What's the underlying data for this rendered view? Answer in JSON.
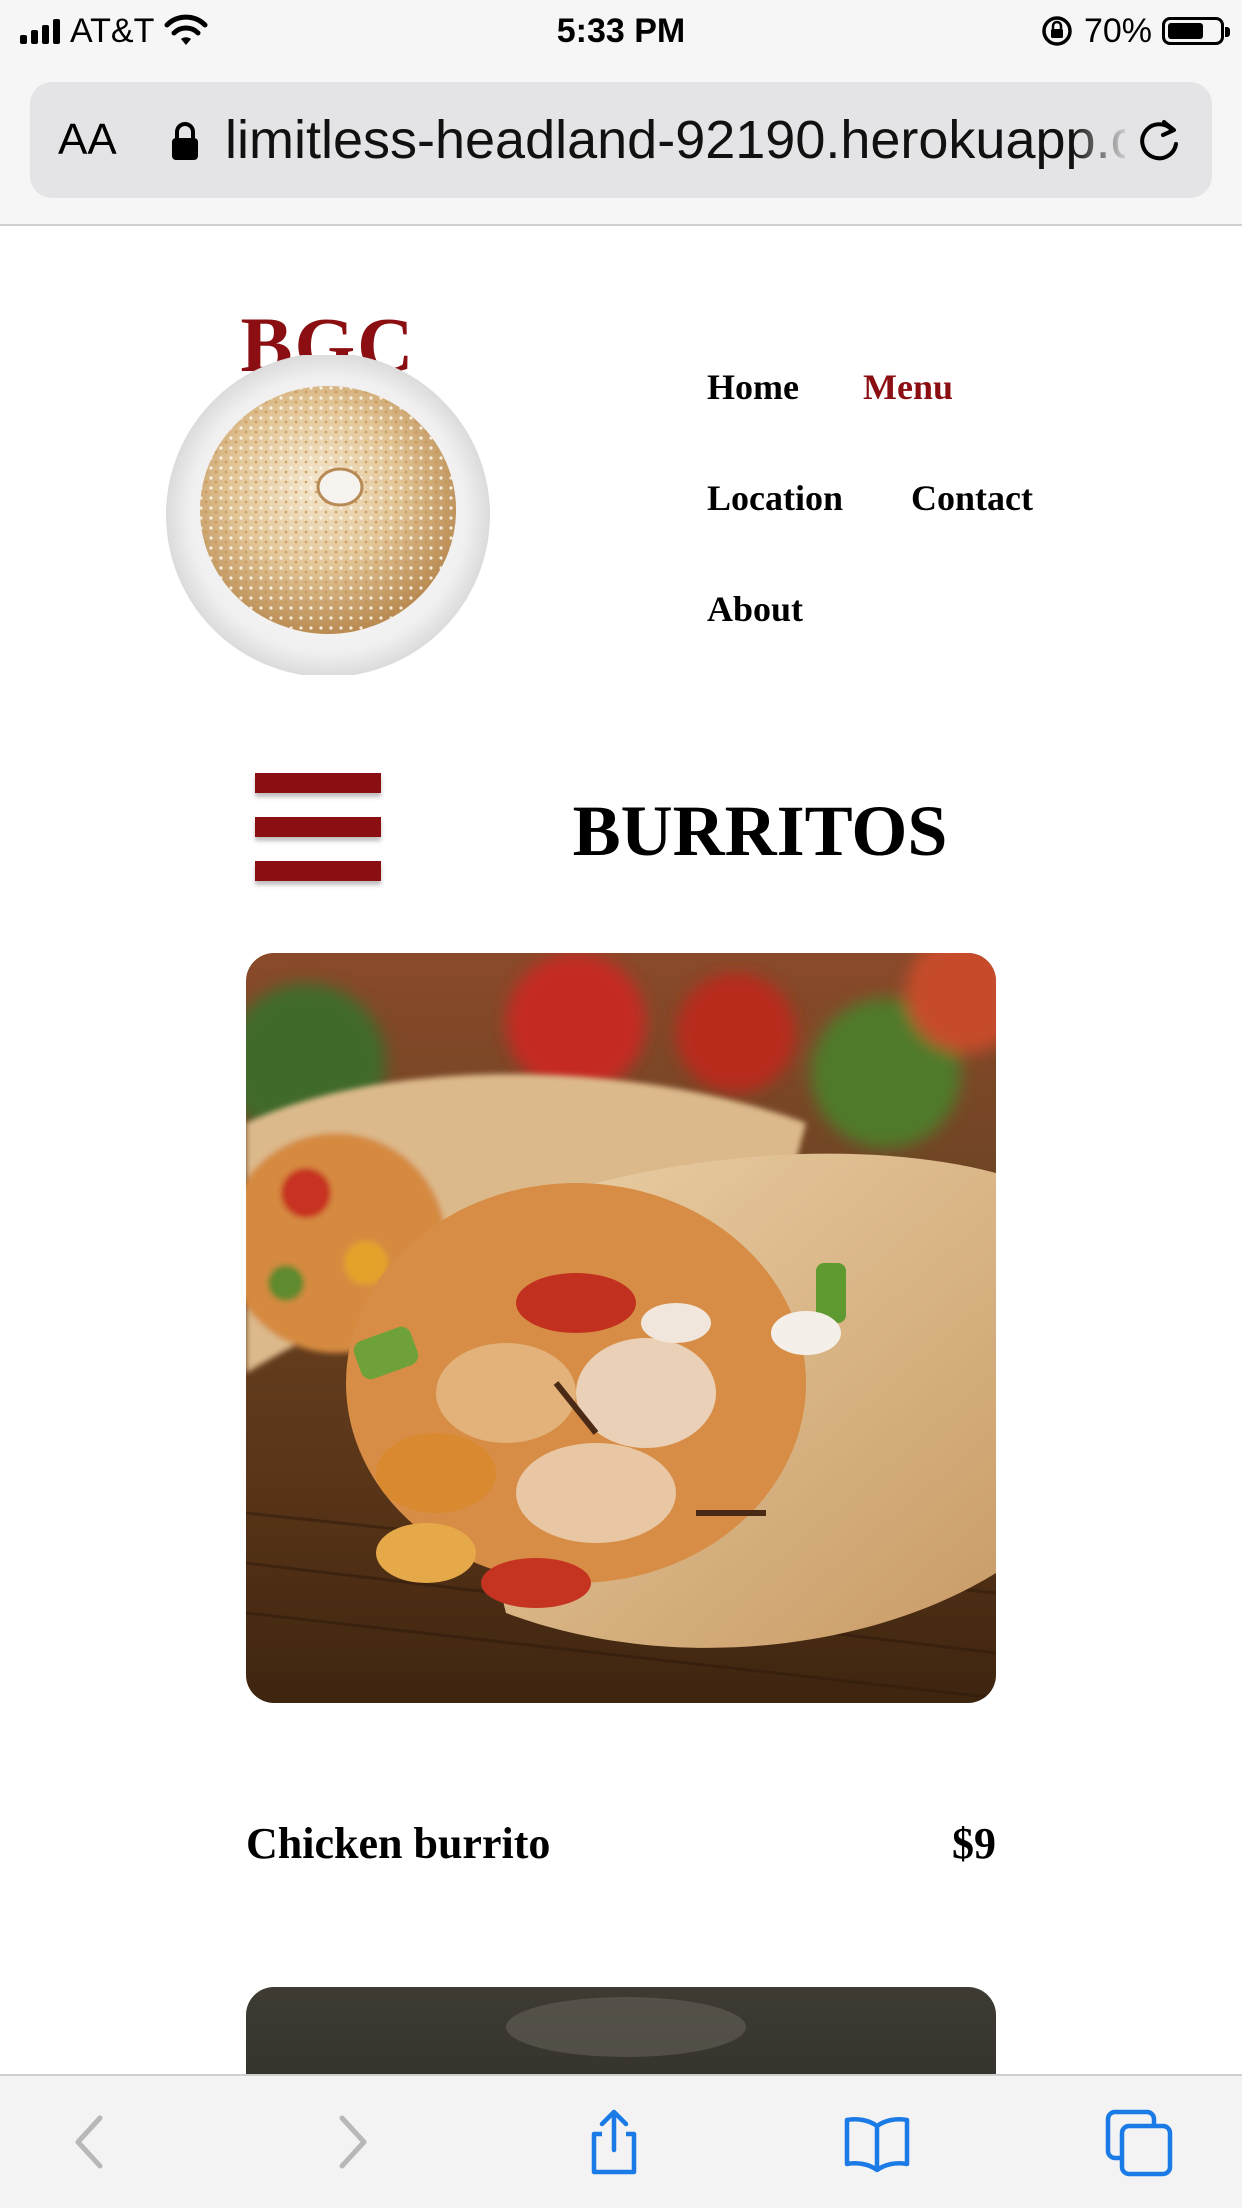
{
  "status_bar": {
    "carrier": "AT&T",
    "time": "5:33 PM",
    "battery_percent_label": "70%",
    "battery_level": 0.7
  },
  "browser": {
    "text_size_label": "AA",
    "url": "limitless-headland-92190.herokuapp.com"
  },
  "site": {
    "logo_text": "BGC",
    "nav": [
      {
        "label": "Home",
        "active": false
      },
      {
        "label": "Menu",
        "active": true
      },
      {
        "label": "Location",
        "active": false
      },
      {
        "label": "Contact",
        "active": false
      },
      {
        "label": "About",
        "active": false
      }
    ],
    "section_title": "BURRITOS",
    "items": [
      {
        "name": "Chicken burrito",
        "price": "$9"
      }
    ]
  },
  "colors": {
    "brand": "#8b0f12",
    "ios_blue": "#1a7ae6",
    "ios_gray": "#b8b8b8"
  },
  "toolbar": {
    "icons": [
      "back-icon",
      "forward-icon",
      "share-icon",
      "bookmarks-icon",
      "tabs-icon"
    ]
  }
}
